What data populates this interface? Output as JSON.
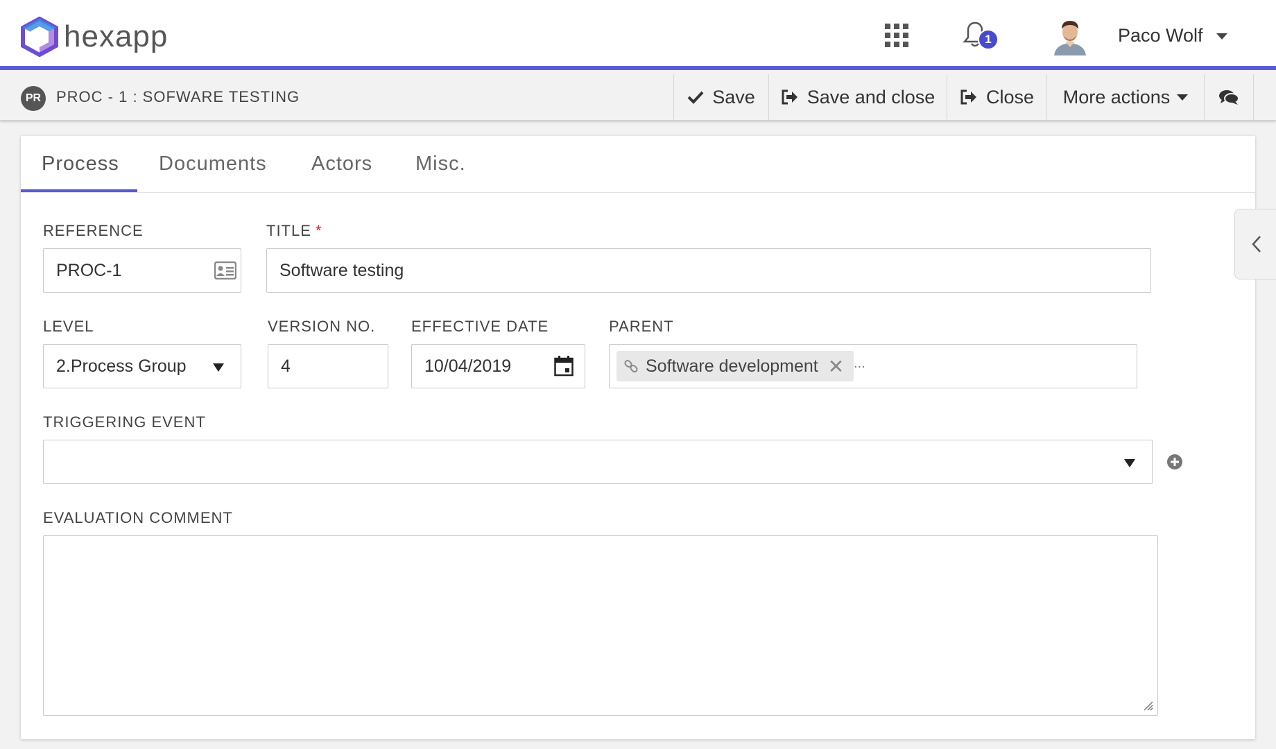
{
  "navbar": {
    "logo_text": "hexapp",
    "notifications_count": "1",
    "user_name": "Paco Wolf",
    "accent_color": "#5b5bd6"
  },
  "toolbar": {
    "badge": "PR",
    "document_title": "PROC - 1 : SOFWARE TESTING",
    "save_label": "Save",
    "save_close_label": "Save and close",
    "close_label": "Close",
    "more_actions_label": "More actions"
  },
  "tabs": [
    {
      "label": "Process",
      "active": true
    },
    {
      "label": "Documents",
      "active": false
    },
    {
      "label": "Actors",
      "active": false
    },
    {
      "label": "Misc.",
      "active": false
    }
  ],
  "form": {
    "reference": {
      "label": "REFERENCE",
      "value": "PROC-1"
    },
    "title": {
      "label": "TITLE",
      "required_mark": "*",
      "value": "Software testing"
    },
    "level": {
      "label": "LEVEL",
      "value": "2.Process Group"
    },
    "version": {
      "label": "VERSION NO.",
      "value": "4"
    },
    "effective_date": {
      "label": "EFFECTIVE DATE",
      "value": "10/04/2019"
    },
    "parent": {
      "label": "PARENT",
      "tag": "Software development",
      "more": "..."
    },
    "triggering_event": {
      "label": "TRIGGERING EVENT",
      "value": ""
    },
    "evaluation_comment": {
      "label": "EVALUATION COMMENT",
      "value": ""
    }
  }
}
